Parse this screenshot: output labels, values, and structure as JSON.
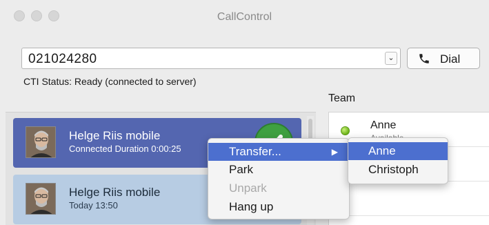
{
  "window": {
    "title": "CallControl"
  },
  "dialer": {
    "number_value": "021024280",
    "dropdown_glyph": "⌄",
    "dial_label": "Dial",
    "dial_icon": "phone-icon"
  },
  "status": {
    "cti_text": "CTI Status: Ready (connected to server)"
  },
  "team": {
    "title": "Team",
    "members": [
      {
        "name": "Anne",
        "status": "Available",
        "status_color": "#6cb319"
      }
    ]
  },
  "calls": [
    {
      "name": "Helge Riis mobile",
      "detail": "Connected Duration 0:00:25",
      "state": "active"
    },
    {
      "name": "Helge Riis mobile",
      "detail": "Today 13:50",
      "state": "inactive"
    }
  ],
  "context_menu": {
    "items": [
      {
        "label": "Transfer...",
        "state": "highlighted",
        "submenu_arrow": "▶"
      },
      {
        "label": "Park",
        "state": "enabled"
      },
      {
        "label": "Unpark",
        "state": "disabled"
      },
      {
        "label": "Hang up",
        "state": "enabled"
      }
    ]
  },
  "transfer_submenu": {
    "items": [
      {
        "label": "Anne",
        "state": "highlighted"
      },
      {
        "label": "Christoph",
        "state": "enabled"
      }
    ]
  },
  "colors": {
    "active_call_bg": "#5466b0",
    "inactive_call_bg": "#b7cce3",
    "menu_highlight": "#4c6fcf",
    "answer_green": "#3fa041"
  }
}
